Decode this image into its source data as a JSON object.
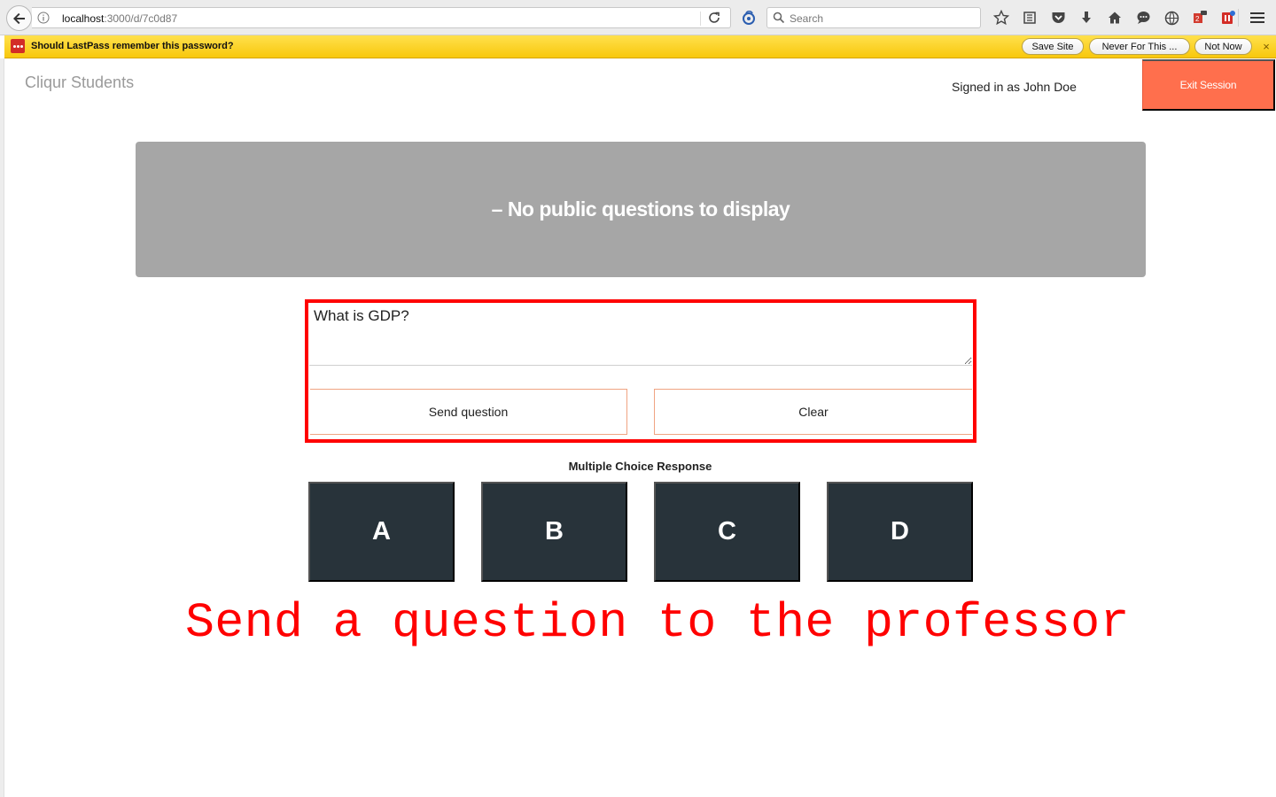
{
  "browser": {
    "url_host": "localhost",
    "url_path": ":3000/d/7c0d87",
    "search_placeholder": "Search"
  },
  "lastpass": {
    "message": "Should LastPass remember this password?",
    "save_site": "Save Site",
    "never": "Never For This ...",
    "not_now": "Not Now",
    "close": "×"
  },
  "header": {
    "brand": "Cliqur Students",
    "signed_in": "Signed in as John Doe",
    "exit_label": "Exit Session"
  },
  "questions": {
    "empty_text": "– No public questions to display"
  },
  "ask": {
    "value": "What is GDP?",
    "send_label": "Send question",
    "clear_label": "Clear"
  },
  "multiple_choice": {
    "title": "Multiple Choice Response",
    "options": [
      "A",
      "B",
      "C",
      "D"
    ]
  },
  "annotation": {
    "text": "Send a question to the professor",
    "color": "#ff0000"
  },
  "colors": {
    "exit_button": "#ff6f4d",
    "choice_button": "#28333a",
    "questions_panel": "#a6a6a6",
    "lastpass_bar": "#f8c80c"
  },
  "icons": [
    "back-arrow-icon",
    "info-icon",
    "reload-icon",
    "search-engine-icon",
    "search-icon",
    "bookmark-star-icon",
    "reading-list-icon",
    "pocket-icon",
    "download-icon",
    "home-icon",
    "chat-icon",
    "vpn-icon",
    "extension-icon",
    "lastpass-icon",
    "hamburger-menu-icon"
  ]
}
